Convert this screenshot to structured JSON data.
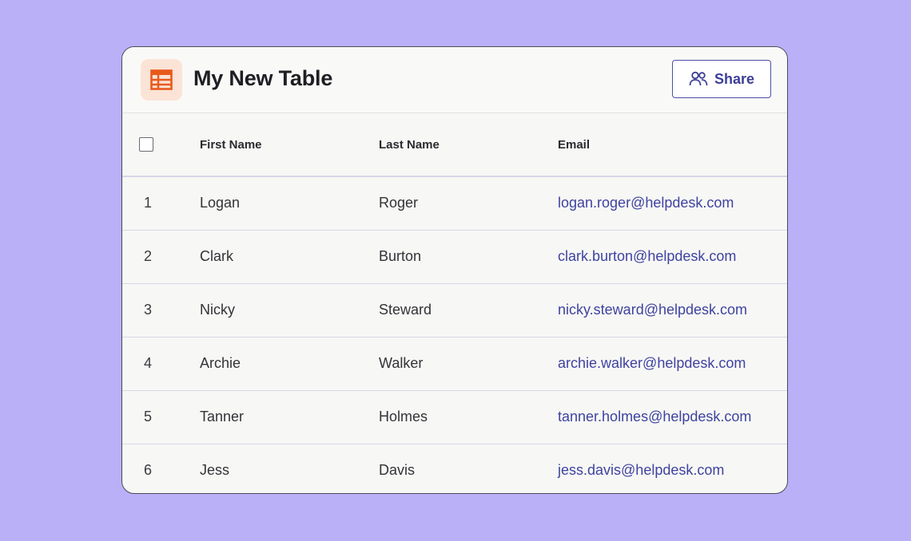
{
  "header": {
    "title": "My New Table",
    "share_label": "Share",
    "icon": "table-icon",
    "share_icon": "users-icon"
  },
  "colors": {
    "background": "#b9b0f7",
    "accent": "#3c3f96",
    "icon_color": "#e85a1c",
    "icon_bg": "#fbe3d6"
  },
  "table": {
    "columns": [
      "First Name",
      "Last Name",
      "Email"
    ],
    "rows": [
      {
        "num": "1",
        "first": "Logan",
        "last": "Roger",
        "email": "logan.roger@helpdesk.com"
      },
      {
        "num": "2",
        "first": "Clark",
        "last": "Burton",
        "email": "clark.burton@helpdesk.com"
      },
      {
        "num": "3",
        "first": "Nicky",
        "last": "Steward",
        "email": "nicky.steward@helpdesk.com"
      },
      {
        "num": "4",
        "first": "Archie",
        "last": "Walker",
        "email": "archie.walker@helpdesk.com"
      },
      {
        "num": "5",
        "first": "Tanner",
        "last": "Holmes",
        "email": "tanner.holmes@helpdesk.com"
      },
      {
        "num": "6",
        "first": "Jess",
        "last": "Davis",
        "email": "jess.davis@helpdesk.com"
      }
    ]
  }
}
